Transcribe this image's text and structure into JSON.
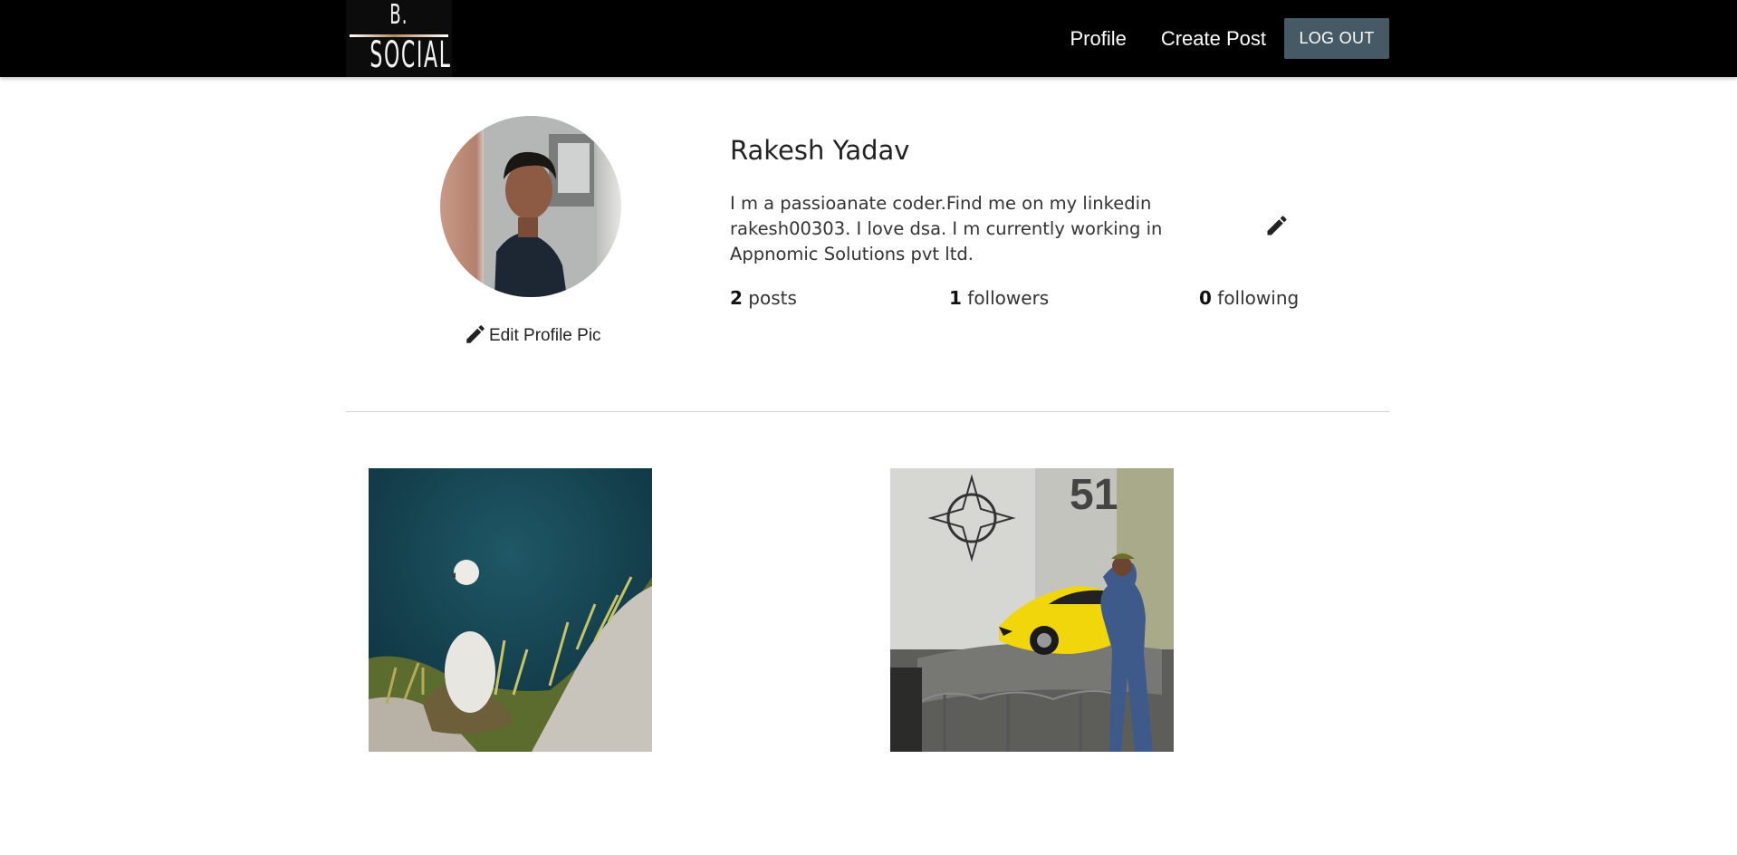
{
  "logo": {
    "letter": "B.",
    "word": "SOCIAL"
  },
  "nav": {
    "profile": "Profile",
    "create_post": "Create Post",
    "logout": "LOG OUT"
  },
  "profile": {
    "name": "Rakesh Yadav",
    "bio": "I m a passioanate coder.Find me on my linkedin rakesh00303. I love dsa. I m currently working in Appnomic Solutions pvt ltd.",
    "edit_pic_label": "Edit Profile Pic",
    "stats": {
      "posts_count": "2",
      "posts_label": "posts",
      "followers_count": "1",
      "followers_label": "followers",
      "following_count": "0",
      "following_label": "following"
    }
  },
  "colors": {
    "navbar": "#000000",
    "logout_button": "#455a64"
  },
  "icons": [
    "pencil-icon"
  ],
  "posts": [
    {
      "subject": "bird chick on cliff"
    },
    {
      "subject": "man next to yellow car"
    }
  ]
}
